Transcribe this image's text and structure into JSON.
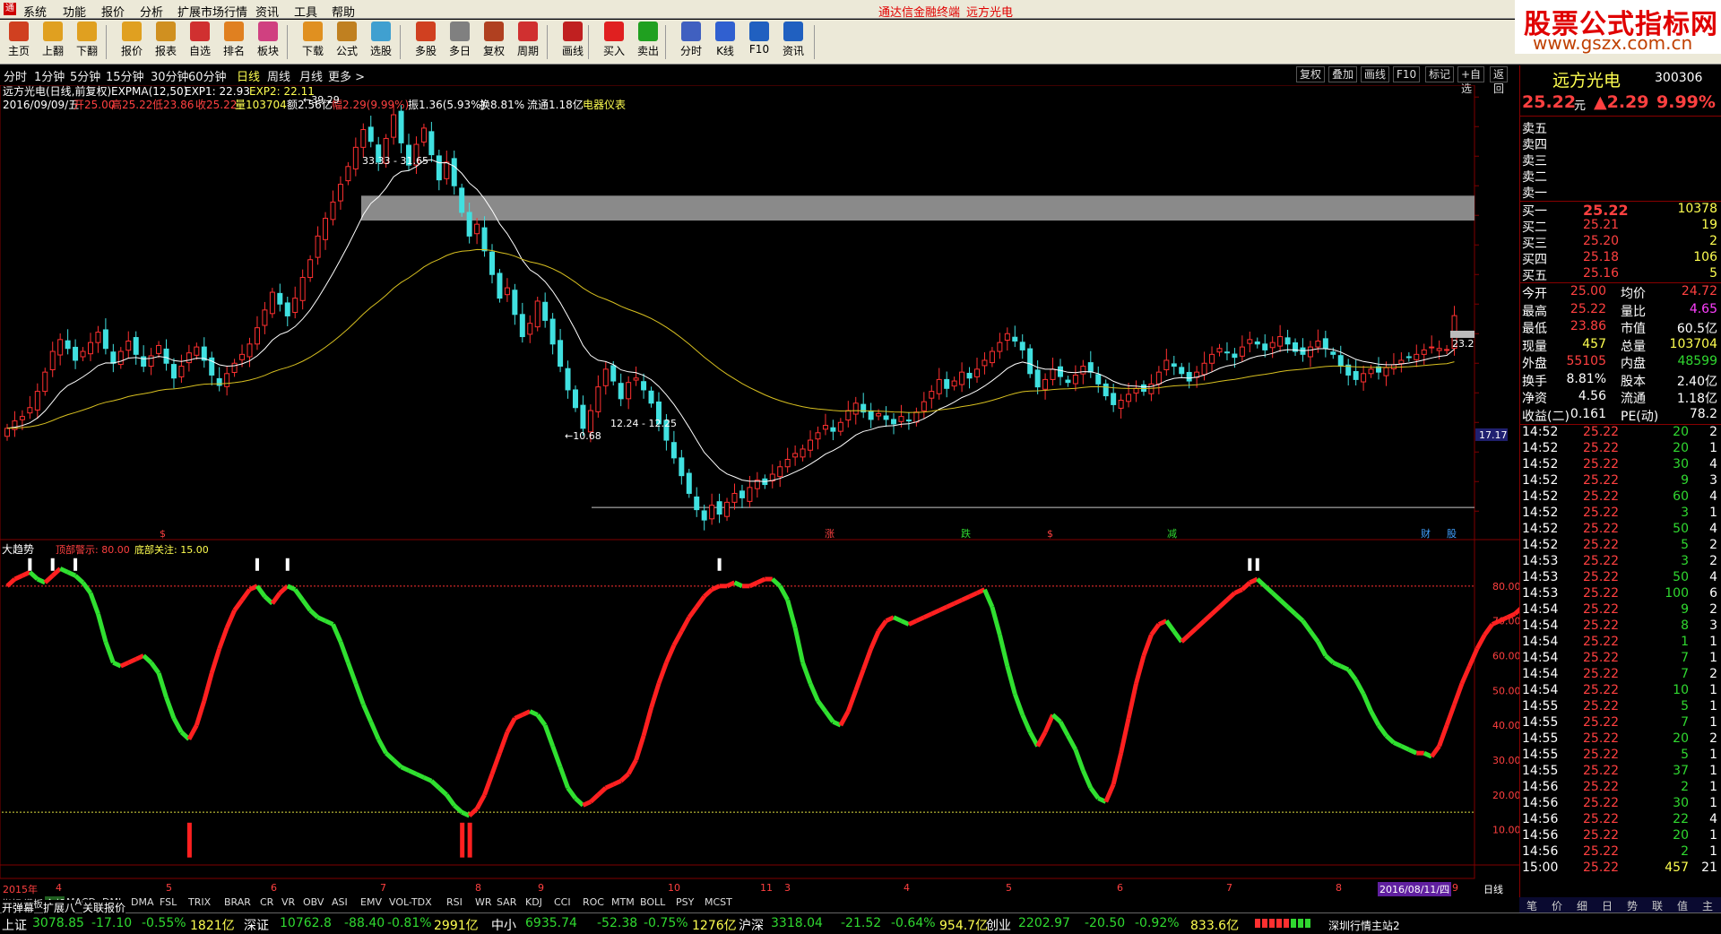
{
  "menu": {
    "items": [
      "系统",
      "功能",
      "报价",
      "分析",
      "扩展市场行情",
      "资讯",
      "工具",
      "帮助"
    ],
    "title_terminal": "通达信金融终端",
    "title_stock": "远方光电"
  },
  "watermark": {
    "line1": "股票公式指标网",
    "line2": "www.gszx.com.cn"
  },
  "toolbar": {
    "buttons": [
      "主页",
      "上翻",
      "下翻",
      "报价",
      "报表",
      "自选",
      "排名",
      "板块",
      "下载",
      "公式",
      "选股",
      "多股",
      "多日",
      "复权",
      "周期",
      "画线",
      "买入",
      "卖出",
      "分时",
      "K线",
      "F10",
      "资讯"
    ]
  },
  "periods": {
    "items": [
      "分时",
      "1分钟",
      "5分钟",
      "15分钟",
      "30分钟",
      "60分钟",
      "日线",
      "周线",
      "月线",
      "更多 >"
    ],
    "selected": "日线"
  },
  "chart_buttons": [
    "复权",
    "叠加",
    "画线",
    "F10",
    "标记",
    "+自选",
    "返回"
  ],
  "kline_header": {
    "title": "远方光电(日线,前复权)",
    "ind": "EXPMA(12,50)",
    "exp1": "EXP1: 22.93",
    "exp2": "EXP2: 22.11",
    "date": "2016/09/09/五",
    "kai": "开25.00",
    "gao": "高25.22",
    "di": "低23.86",
    "shou": "收25.22",
    "vol": "量103704",
    "amt": "额2.56亿",
    "fu": "幅2.29(9.99%)",
    "zhen": "振1.36(5.93%)",
    "huan": "换8.81%",
    "liu": "流通1.18亿",
    "sector": "电器仪表"
  },
  "annotations": {
    "high": "39.29",
    "band": "33.33 - 31.65",
    "low": "10.68",
    "low_band": "12.24 - 12.25",
    "right_val": "23.2",
    "cur_marker": "17.17"
  },
  "event_marks": [
    "$",
    "涨",
    "跌",
    "$",
    "减",
    "财",
    "股"
  ],
  "sub_header": {
    "name": "大趋势",
    "top_label": "顶部警示: 80.00",
    "bottom_label": "底部关注: 15.00"
  },
  "date_axis": {
    "year": "2015年",
    "labels": [
      "4",
      "5",
      "6",
      "7",
      "8",
      "9",
      "10",
      "11",
      "3",
      "4",
      "5",
      "6",
      "7",
      "8",
      "9"
    ],
    "cursor_date": "2016/08/11/四",
    "tab": "日线"
  },
  "indicator_tabs": [
    "指标",
    "模板",
    "全部",
    "MACD",
    "DMI",
    "DMA",
    "FSL",
    "TRIX",
    "BRAR",
    "CR",
    "VR",
    "OBV",
    "ASI",
    "EMV",
    "VOL-TDX",
    "RSI",
    "WR",
    "SAR",
    "KDJ",
    "CCI",
    "ROC",
    "MTM",
    "BOLL",
    "PSY",
    "MCST"
  ],
  "bottom_tabs": [
    "开弹幕",
    "扩展八",
    "关联报价"
  ],
  "quote": {
    "name": "远方光电",
    "code": "300306",
    "price": "25.22",
    "price_unit": "元",
    "change": "▲2.29",
    "pct": "9.99%",
    "sell": [
      "卖五",
      "卖四",
      "卖三",
      "卖二",
      "卖一"
    ],
    "buy": [
      [
        "买一",
        "25.22",
        "10378"
      ],
      [
        "买二",
        "25.21",
        "19"
      ],
      [
        "买三",
        "25.20",
        "2"
      ],
      [
        "买四",
        "25.18",
        "106"
      ],
      [
        "买五",
        "25.16",
        "5"
      ]
    ],
    "stats": [
      [
        "今开",
        "25.00",
        "均价",
        "24.72"
      ],
      [
        "最高",
        "25.22",
        "量比",
        "4.65"
      ],
      [
        "最低",
        "23.86",
        "市值",
        "60.5亿"
      ],
      [
        "现量",
        "457",
        "总量",
        "103704"
      ],
      [
        "外盘",
        "55105",
        "内盘",
        "48599"
      ],
      [
        "换手",
        "8.81%",
        "股本",
        "2.40亿"
      ],
      [
        "净资",
        "4.56",
        "流通",
        "1.18亿"
      ],
      [
        "收益(二)",
        "0.161",
        "PE(动)",
        "78.2"
      ]
    ],
    "ticks": [
      [
        "14:52",
        "25.22",
        "20",
        "2"
      ],
      [
        "14:52",
        "25.22",
        "20",
        "1"
      ],
      [
        "14:52",
        "25.22",
        "30",
        "4"
      ],
      [
        "14:52",
        "25.22",
        "9",
        "3"
      ],
      [
        "14:52",
        "25.22",
        "60",
        "4"
      ],
      [
        "14:52",
        "25.22",
        "3",
        "1"
      ],
      [
        "14:52",
        "25.22",
        "50",
        "4"
      ],
      [
        "14:52",
        "25.22",
        "5",
        "2"
      ],
      [
        "14:53",
        "25.22",
        "3",
        "2"
      ],
      [
        "14:53",
        "25.22",
        "50",
        "4"
      ],
      [
        "14:53",
        "25.22",
        "100",
        "6"
      ],
      [
        "14:54",
        "25.22",
        "9",
        "2"
      ],
      [
        "14:54",
        "25.22",
        "8",
        "3"
      ],
      [
        "14:54",
        "25.22",
        "1",
        "1"
      ],
      [
        "14:54",
        "25.22",
        "7",
        "1"
      ],
      [
        "14:54",
        "25.22",
        "7",
        "2"
      ],
      [
        "14:54",
        "25.22",
        "10",
        "1"
      ],
      [
        "14:55",
        "25.22",
        "5",
        "1"
      ],
      [
        "14:55",
        "25.22",
        "7",
        "1"
      ],
      [
        "14:55",
        "25.22",
        "20",
        "2"
      ],
      [
        "14:55",
        "25.22",
        "5",
        "1"
      ],
      [
        "14:55",
        "25.22",
        "37",
        "1"
      ],
      [
        "14:56",
        "25.22",
        "2",
        "1"
      ],
      [
        "14:56",
        "25.22",
        "30",
        "1"
      ],
      [
        "14:56",
        "25.22",
        "22",
        "4"
      ],
      [
        "14:56",
        "25.22",
        "20",
        "1"
      ],
      [
        "14:56",
        "25.22",
        "2",
        "1"
      ],
      [
        "15:00",
        "25.22",
        "457",
        "21"
      ]
    ],
    "foot": [
      "笔",
      "价",
      "细",
      "日",
      "势",
      "联",
      "值",
      "主"
    ]
  },
  "statusbar": {
    "items": [
      "上证",
      "3078.85",
      "-17.10",
      "-0.55%",
      "1821亿",
      "深证",
      "10762.8",
      "-88.40",
      "-0.81%",
      "2991亿",
      "中小",
      "6935.74",
      "-52.38",
      "-0.75%",
      "1276亿",
      "沪深",
      "3318.04",
      "-21.52",
      "-0.64%",
      "954.7亿",
      "创业",
      "2202.97",
      "-20.50",
      "-0.92%",
      "833.6亿",
      "深圳行情主站2"
    ]
  },
  "chart_data": [
    {
      "type": "candlestick",
      "name": "K线",
      "y_axis": [
        "40.00",
        "38.00",
        "36.00",
        "34.00",
        "32.00",
        "30.00",
        "28.00",
        "26.00",
        "24.00",
        "22.00",
        "20.00",
        "18.00",
        "16.00",
        "14.00",
        "12.00"
      ],
      "ylim": [
        10.5,
        40.5
      ],
      "high": 39.29,
      "low": 10.68,
      "last_close": 25.22,
      "resistance_band": [
        31.65,
        33.33
      ],
      "support_line": 12.25,
      "closes": [
        17.6,
        18.1,
        18.4,
        19.0,
        20.1,
        21.4,
        22.8,
        23.6,
        23.0,
        22.2,
        22.8,
        23.4,
        24.1,
        23.0,
        22.0,
        22.8,
        23.5,
        22.6,
        21.8,
        22.5,
        23.2,
        22.0,
        21.0,
        21.8,
        22.7,
        23.1,
        22.2,
        21.2,
        20.5,
        21.3,
        22.0,
        22.6,
        23.3,
        24.4,
        25.6,
        26.8,
        26.0,
        25.2,
        26.4,
        27.8,
        29.0,
        30.6,
        31.8,
        32.9,
        34.1,
        35.3,
        36.6,
        37.8,
        37.0,
        35.6,
        37.2,
        38.8,
        36.9,
        35.4,
        36.8,
        37.9,
        36.1,
        34.4,
        35.6,
        34.0,
        32.2,
        30.6,
        31.4,
        29.6,
        28.0,
        26.4,
        27.1,
        25.3,
        23.8,
        24.7,
        26.2,
        24.9,
        23.3,
        21.8,
        20.2,
        19.0,
        17.6,
        18.8,
        20.4,
        21.6,
        20.8,
        19.6,
        20.7,
        21.0,
        20.2,
        19.3,
        17.9,
        16.8,
        15.6,
        14.4,
        13.2,
        12.1,
        11.4,
        12.4,
        11.8,
        12.6,
        13.2,
        12.9,
        13.6,
        14.1,
        13.8,
        14.5,
        15.0,
        15.5,
        15.9,
        16.2,
        16.8,
        17.3,
        17.8,
        17.4,
        18.0,
        18.8,
        19.3,
        18.7,
        18.2,
        18.6,
        18.2,
        17.9,
        18.4,
        18.1,
        18.7,
        19.4,
        20.1,
        20.9,
        20.3,
        20.8,
        21.4,
        21.0,
        21.6,
        22.2,
        22.8,
        23.4,
        24.0,
        23.5,
        22.9,
        21.3,
        20.4,
        20.9,
        21.6,
        21.1,
        20.7,
        21.2,
        21.8,
        21.4,
        20.6,
        19.8,
        19.2,
        19.5,
        19.9,
        20.3,
        20.1,
        20.6,
        21.4,
        22.2,
        21.8,
        21.3,
        20.8,
        21.4,
        22.0,
        22.6,
        23.0,
        22.7,
        22.4,
        23.1,
        23.6,
        23.3,
        22.9,
        23.4,
        23.8,
        23.3,
        22.8,
        22.6,
        23.1,
        23.5,
        23.0,
        22.6,
        21.8,
        21.2,
        20.9,
        21.3,
        21.6,
        21.4,
        21.7,
        21.9,
        22.2,
        22.4,
        22.6,
        22.9,
        23.1,
        23.0,
        22.93,
        25.22
      ]
    },
    {
      "type": "line",
      "name": "EXP1",
      "value": 22.93
    },
    {
      "type": "line",
      "name": "EXP2",
      "value": 22.11
    },
    {
      "type": "line",
      "name": "大趋势",
      "y_axis": [
        "80.00",
        "70.00",
        "60.00",
        "50.00",
        "40.00",
        "30.00",
        "20.00",
        "10.00"
      ],
      "ylim": [
        5,
        90
      ],
      "thresholds": [
        80,
        15
      ],
      "values": [
        80,
        82,
        83,
        84,
        82,
        81,
        83,
        85,
        84,
        83,
        81,
        78,
        72,
        64,
        58,
        57,
        58,
        59,
        60,
        58,
        55,
        48,
        42,
        38,
        36,
        40,
        47,
        55,
        62,
        68,
        73,
        76,
        79,
        80,
        77,
        75,
        78,
        80,
        79,
        76,
        73,
        71,
        70,
        69,
        64,
        58,
        52,
        46,
        41,
        36,
        32,
        30,
        28,
        27,
        26,
        25,
        24,
        22,
        20,
        17,
        15,
        14,
        16,
        20,
        26,
        32,
        38,
        42,
        43,
        44,
        43,
        40,
        34,
        28,
        22,
        19,
        17,
        18,
        20,
        22,
        23,
        24,
        26,
        30,
        37,
        45,
        52,
        58,
        63,
        67,
        71,
        74,
        77,
        79,
        80,
        80,
        81,
        80,
        80,
        81,
        82,
        82,
        80,
        76,
        68,
        58,
        52,
        47,
        44,
        41,
        40,
        44,
        50,
        56,
        62,
        67,
        70,
        71,
        70,
        69,
        70,
        71,
        72,
        73,
        74,
        75,
        76,
        77,
        78,
        79,
        74,
        66,
        57,
        49,
        43,
        38,
        34,
        38,
        43,
        41,
        37,
        33,
        27,
        22,
        19,
        18,
        23,
        32,
        42,
        52,
        60,
        66,
        69,
        70,
        67,
        64,
        66,
        68,
        70,
        72,
        74,
        76,
        78,
        79,
        81,
        82,
        80,
        78,
        76,
        74,
        72,
        70,
        67,
        64,
        60,
        58,
        57,
        56,
        53,
        49,
        44,
        40,
        37,
        35,
        34,
        33,
        32,
        32,
        31,
        34,
        40,
        46,
        52,
        57,
        62,
        66,
        69,
        70,
        71,
        72,
        74,
        76
      ]
    }
  ]
}
